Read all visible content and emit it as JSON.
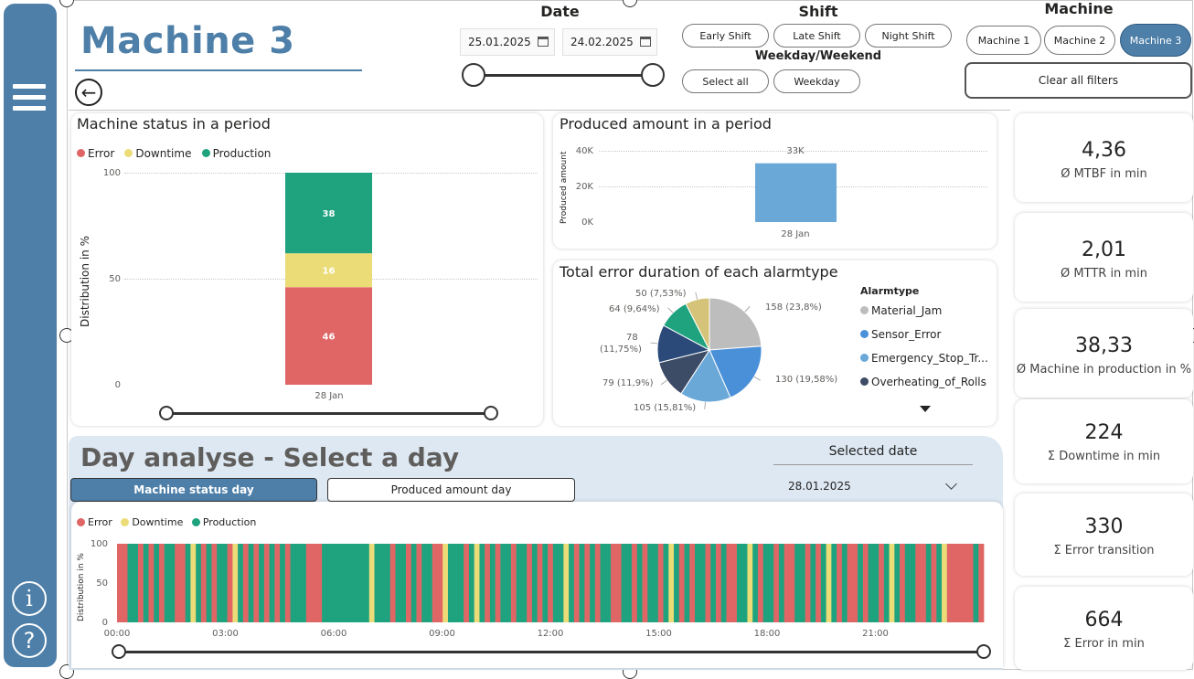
{
  "page": {
    "title": "Machine 3",
    "back_icon": "arrow-left-icon"
  },
  "sidebar": {
    "menu_icon": "hamburger-menu-icon",
    "info_icon": "info-icon",
    "help_icon": "help-icon",
    "info_glyph": "i",
    "help_glyph": "?"
  },
  "filters": {
    "date_label": "Date",
    "date_from": "25.01.2025",
    "date_to": "24.02.2025",
    "shift_label": "Shift",
    "shifts": [
      "Early Shift",
      "Late Shift",
      "Night Shift"
    ],
    "weekday_label": "Weekday/Weekend",
    "weekday_options": [
      "Select all",
      "Weekday"
    ],
    "machine_label": "Machine",
    "machines": [
      "Machine 1",
      "Machine 2",
      "Machine 3"
    ],
    "machine_selected": "Machine 3",
    "clear_label": "Clear all filters"
  },
  "colors": {
    "error": "#e06666",
    "downtime": "#ebdc78",
    "production": "#1fa37f",
    "bar": "#6aa8d8",
    "accent": "#4e7fa8"
  },
  "status_chart": {
    "title": "Machine status in a period",
    "legend": [
      "Error",
      "Downtime",
      "Production"
    ],
    "ylabel": "Distribution in %",
    "yticks": [
      "100",
      "50",
      "0"
    ],
    "xlabel": "28 Jan"
  },
  "produced_chart": {
    "title": "Produced amount in a period",
    "ylabel": "Produced amount",
    "yticks": [
      "40K",
      "20K",
      "0K"
    ],
    "xlabel": "28 Jan",
    "value_label": "33K"
  },
  "pie_chart": {
    "title": "Total error duration of each alarmtype",
    "legend_title": "Alarmtype",
    "legend": [
      "Material_Jam",
      "Sensor_Error",
      "Emergency_Stop_Tr...",
      "Overheating_of_Rolls"
    ],
    "labels": [
      "158 (23,8%)",
      "130 (19,58%)",
      "105 (15,81%)",
      "79 (11,9%)",
      "78",
      "(11,75%)",
      "64 (9,64%)",
      "50 (7,53%)"
    ],
    "more_icon": "caret-down-icon"
  },
  "kpis": [
    {
      "value": "4,36",
      "label": "Ø MTBF in min"
    },
    {
      "value": "2,01",
      "label": "Ø MTTR in min"
    },
    {
      "value": "38,33",
      "label": "Ø Machine in production in %"
    },
    {
      "value": "224",
      "label": "Σ Downtime in min"
    },
    {
      "value": "330",
      "label": "Σ Error transition"
    },
    {
      "value": "664",
      "label": "Σ Error in min"
    }
  ],
  "day": {
    "title": "Day analyse - Select a day",
    "tab_status": "Machine status day",
    "tab_amount": "Produced amount day",
    "selected_date_label": "Selected date",
    "selected_date": "28.01.2025",
    "dropdown_icon": "chevron-down-icon",
    "legend": [
      "Error",
      "Downtime",
      "Production"
    ],
    "ylabel": "Distribution in %",
    "yticks": [
      "100",
      "50",
      "0"
    ],
    "xticks": [
      "00:00",
      "03:00",
      "06:00",
      "09:00",
      "12:00",
      "15:00",
      "18:00",
      "21:00"
    ]
  },
  "chart_data": [
    {
      "type": "bar",
      "title": "Machine status in a period",
      "ylabel": "Distribution in %",
      "categories": [
        "28 Jan"
      ],
      "series": [
        {
          "name": "Error",
          "values": [
            46
          ]
        },
        {
          "name": "Downtime",
          "values": [
            16
          ]
        },
        {
          "name": "Production",
          "values": [
            38
          ]
        }
      ],
      "ylim": [
        0,
        100
      ],
      "stacked": true,
      "legend": "top-left",
      "grid": true
    },
    {
      "type": "bar",
      "title": "Produced amount in a period",
      "ylabel": "Produced amount",
      "categories": [
        "28 Jan"
      ],
      "values": [
        33000
      ],
      "ylim": [
        0,
        40000
      ],
      "grid": true
    },
    {
      "type": "pie",
      "title": "Total error duration of each alarmtype",
      "values": [
        158,
        130,
        105,
        79,
        78,
        64,
        50
      ],
      "percent": [
        23.8,
        19.58,
        15.81,
        11.9,
        11.75,
        9.64,
        7.53
      ],
      "colors": [
        "#bdbdbd",
        "#4a90d9",
        "#6aa8d8",
        "#3d4c66",
        "#2b4a7a",
        "#1fa37f",
        "#d6c37a"
      ],
      "legend": "right"
    },
    {
      "type": "bar",
      "title": "Machine status day",
      "ylabel": "Distribution in %",
      "ylim": [
        0,
        100
      ],
      "x_range": [
        "00:00",
        "24:00"
      ],
      "states": [
        "E",
        "E",
        "P",
        "P",
        "E",
        "P",
        "E",
        "P",
        "E",
        "P",
        "P",
        "E",
        "E",
        "P",
        "D",
        "P",
        "E",
        "P",
        "E",
        "P",
        "P",
        "E",
        "D",
        "P",
        "E",
        "P",
        "E",
        "P",
        "E",
        "P",
        "E",
        "P",
        "E",
        "P",
        "P",
        "P",
        "E",
        "E",
        "E",
        "P",
        "P",
        "P",
        "P",
        "P",
        "P",
        "P",
        "P",
        "P",
        "D",
        "P",
        "P",
        "P",
        "E",
        "P",
        "P",
        "E",
        "P",
        "E",
        "P",
        "P",
        "E",
        "E",
        "D",
        "P",
        "P",
        "P",
        "E",
        "P",
        "D",
        "P",
        "E",
        "P",
        "E",
        "P",
        "P",
        "E",
        "P",
        "P",
        "E",
        "P",
        "E",
        "P",
        "E",
        "P",
        "P",
        "D",
        "P",
        "E",
        "P",
        "E",
        "P",
        "E",
        "P",
        "P",
        "E",
        "E",
        "P",
        "P",
        "E",
        "P",
        "E",
        "P",
        "P",
        "E",
        "P",
        "D",
        "P",
        "E",
        "P",
        "E",
        "P",
        "P",
        "E",
        "P",
        "E",
        "P",
        "E",
        "E",
        "P",
        "P",
        "D",
        "P",
        "E",
        "P",
        "P",
        "E",
        "P",
        "E",
        "E",
        "P",
        "P",
        "E",
        "P",
        "E",
        "P",
        "D",
        "P",
        "E",
        "P",
        "E",
        "E",
        "P",
        "E",
        "P",
        "P",
        "E",
        "P",
        "D",
        "P",
        "E",
        "P",
        "P",
        "E",
        "E",
        "P",
        "E",
        "P",
        "D",
        "E",
        "E",
        "E",
        "E",
        "E",
        "P",
        "E"
      ]
    }
  ]
}
